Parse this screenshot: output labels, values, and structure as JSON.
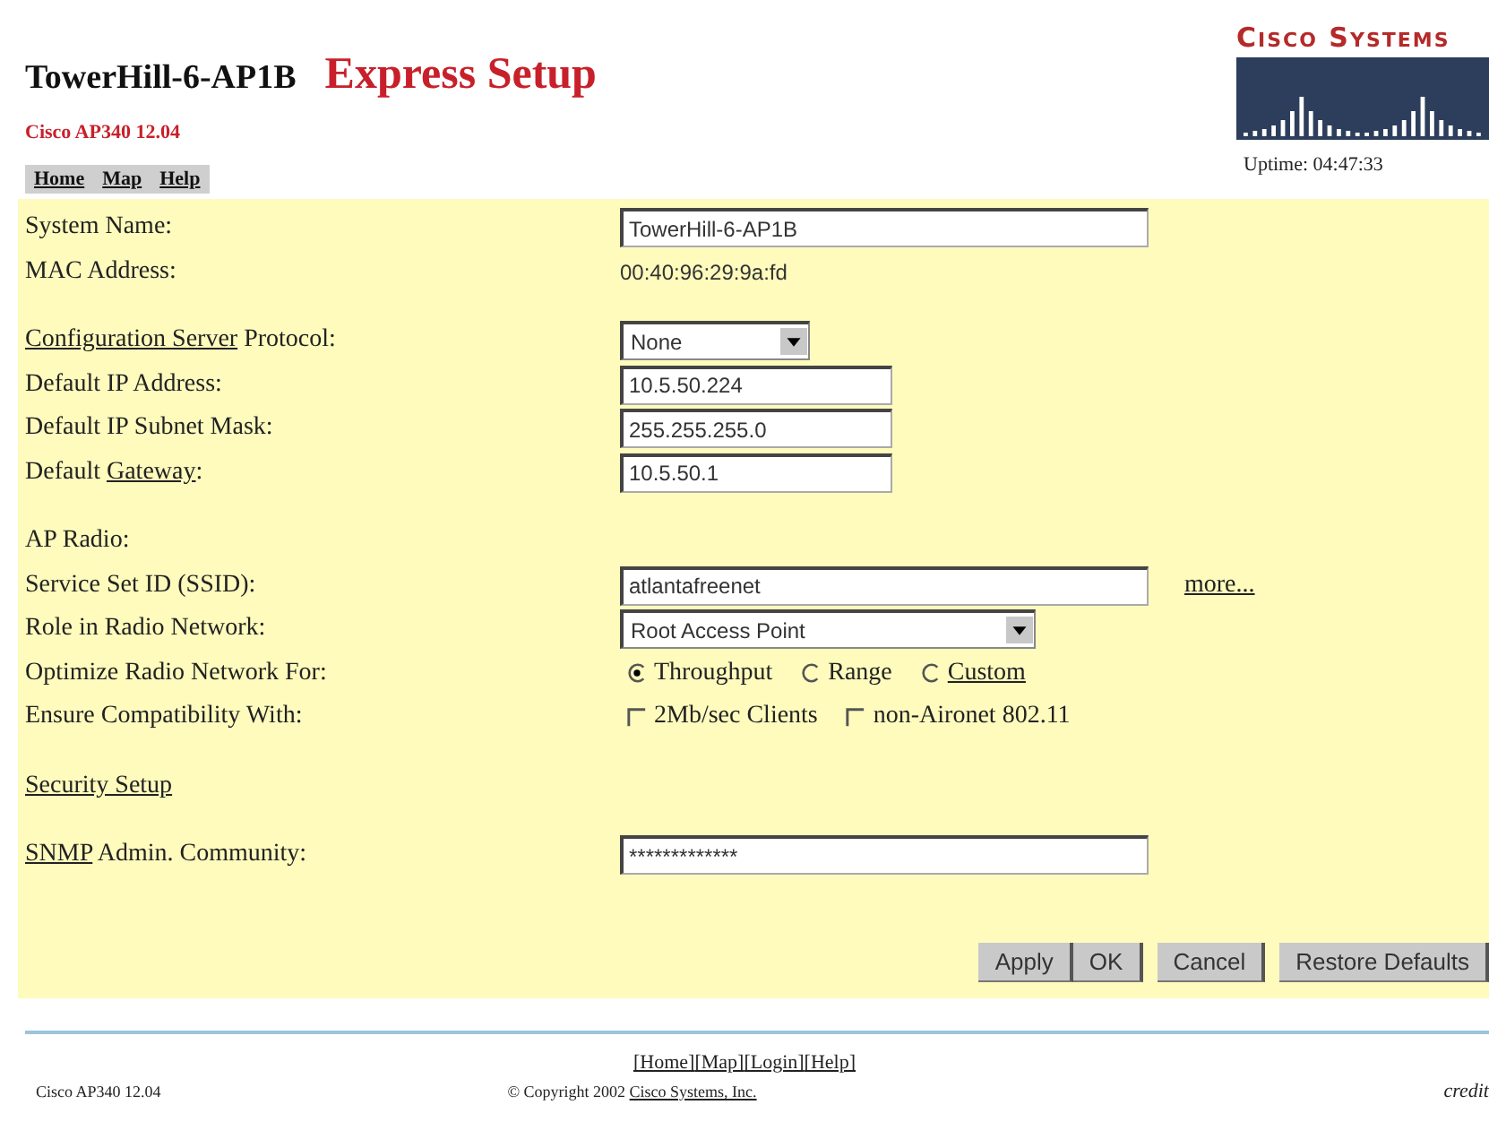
{
  "header": {
    "device_name": "TowerHill-6-AP1B",
    "page_title": "Express Setup",
    "model": "Cisco AP340 12.04",
    "logo_text": "Cisco Systems",
    "uptime": "Uptime: 04:47:33"
  },
  "nav": [
    "Home",
    "Map",
    "Help"
  ],
  "rows": [
    {
      "kind": "text",
      "label": [
        {
          "kind": "plain",
          "text": "System Name:"
        }
      ],
      "value": "TowerHill-6-AP1B",
      "wide": true
    },
    {
      "kind": "static",
      "label": [
        {
          "kind": "plain",
          "text": "MAC Address:"
        }
      ],
      "value": "00:40:96:29:9a:fd"
    },
    {
      "kind": "gap"
    },
    {
      "kind": "select",
      "label": [
        {
          "kind": "link",
          "text": "Configuration Server"
        },
        {
          "kind": "plain",
          "text": " Protocol:"
        }
      ],
      "value": "None",
      "wide": false
    },
    {
      "kind": "text",
      "label": [
        {
          "kind": "plain",
          "text": "Default IP Address:"
        }
      ],
      "value": "10.5.50.224",
      "wide": false
    },
    {
      "kind": "text",
      "label": [
        {
          "kind": "plain",
          "text": "Default IP Subnet Mask:"
        }
      ],
      "value": "255.255.255.0",
      "wide": false
    },
    {
      "kind": "text",
      "label": [
        {
          "kind": "plain",
          "text": "Default "
        },
        {
          "kind": "link",
          "text": "Gateway"
        },
        {
          "kind": "plain",
          "text": ":"
        }
      ],
      "value": "10.5.50.1",
      "wide": false
    },
    {
      "kind": "gap"
    },
    {
      "kind": "heading",
      "label": [
        {
          "kind": "plain",
          "text": "AP Radio:"
        }
      ]
    },
    {
      "kind": "text",
      "label": [
        {
          "kind": "plain",
          "text": "Service Set ID (SSID):"
        }
      ],
      "value": "atlantafreenet",
      "wide": true,
      "more": "more..."
    },
    {
      "kind": "select",
      "label": [
        {
          "kind": "plain",
          "text": "Role in Radio Network:"
        }
      ],
      "value": "Root Access Point",
      "wide": true
    },
    {
      "kind": "radio",
      "label": [
        {
          "kind": "plain",
          "text": "Optimize Radio Network For:"
        }
      ],
      "options": [
        {
          "kind": "plain",
          "text": "Throughput",
          "selected": true
        },
        {
          "kind": "plain",
          "text": "Range",
          "selected": false
        },
        {
          "kind": "link",
          "text": "Custom",
          "selected": false
        }
      ]
    },
    {
      "kind": "checkbox",
      "label": [
        {
          "kind": "plain",
          "text": "Ensure Compatibility With:"
        }
      ],
      "options": [
        {
          "text": "2Mb/sec Clients",
          "checked": false
        },
        {
          "text": "non-Aironet 802.11",
          "checked": false
        }
      ]
    },
    {
      "kind": "gap"
    },
    {
      "kind": "heading",
      "label": [
        {
          "kind": "link",
          "text": "Security Setup"
        }
      ]
    },
    {
      "kind": "gap"
    },
    {
      "kind": "text",
      "label": [
        {
          "kind": "link",
          "text": "SNMP"
        },
        {
          "kind": "plain",
          "text": " Admin. Community:"
        }
      ],
      "value": "*************",
      "wide": true
    }
  ],
  "button_groups": [
    [
      "Apply",
      "OK"
    ],
    [
      "Cancel"
    ],
    [
      "Restore Defaults"
    ]
  ],
  "footer": {
    "links": [
      "[Home]",
      "[Map]",
      "[Login]",
      "[Help]"
    ],
    "model": "Cisco AP340 12.04",
    "copyright": "© Copyright 2002 ",
    "company": "Cisco Systems, Inc.",
    "credit": "credit"
  }
}
